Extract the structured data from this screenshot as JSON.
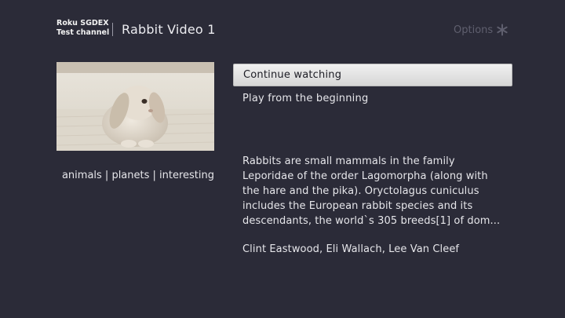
{
  "header": {
    "logo_line1": "Roku SGDEX",
    "logo_line2": "Test channel",
    "title": "Rabbit Video 1",
    "options_label": "Options",
    "options_icon": "asterisk-icon"
  },
  "details": {
    "thumbnail_alt": "rabbit",
    "tags": "animals | planets | interesting",
    "buttons": [
      {
        "label": "Continue watching",
        "focused": true
      },
      {
        "label": "Play from the beginning",
        "focused": false
      }
    ],
    "description": "Rabbits are small mammals in the family Leporidae of the order Lagomorpha (along with the hare and the pika). Oryctolagus cuniculus includes the European rabbit species and its descendants, the world`s 305 breeds[1] of dom...",
    "cast": "Clint Eastwood, Eli Wallach, Lee Van Cleef"
  },
  "colors": {
    "background": "#2b2b38",
    "focus_button": "#e3e3e3",
    "muted_text": "#5f5f6e"
  }
}
